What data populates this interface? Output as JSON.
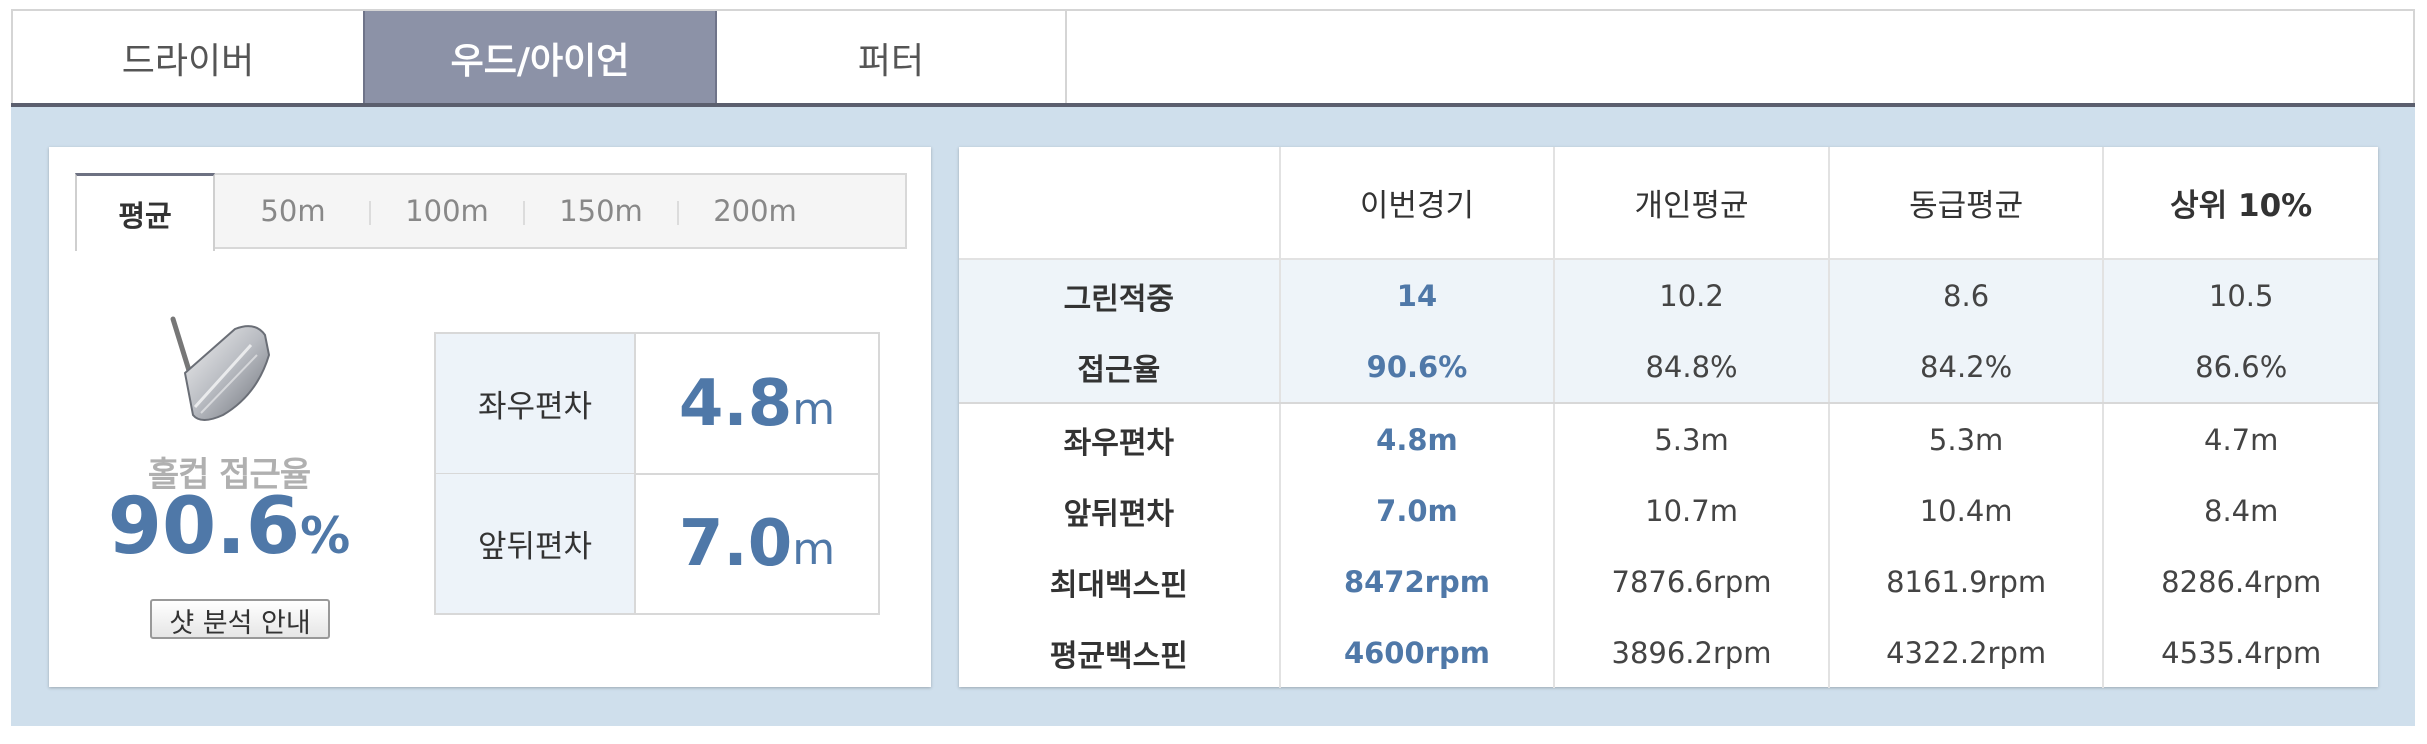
{
  "top_tabs": {
    "driver": "드라이버",
    "wood_iron": "우드/아이언",
    "putter": "퍼터"
  },
  "distance_tabs": [
    "평균",
    "50m",
    "100m",
    "150m",
    "200m"
  ],
  "summary": {
    "holecup_label": "홀컵 접근율",
    "holecup_value": "90.6",
    "holecup_unit": "%",
    "guide_button": "샷 분석 안내",
    "deviation": [
      {
        "label": "좌우편차",
        "value": "4.8",
        "unit": "m"
      },
      {
        "label": "앞뒤편차",
        "value": "7.0",
        "unit": "m"
      }
    ]
  },
  "stats": {
    "columns": [
      "이번경기",
      "개인평균",
      "동급평균",
      "상위 10%"
    ],
    "rows": [
      {
        "label": "그린적중",
        "values": [
          "14",
          "10.2",
          "8.6",
          "10.5"
        ]
      },
      {
        "label": "접근율",
        "values": [
          "90.6%",
          "84.8%",
          "84.2%",
          "86.6%"
        ]
      },
      {
        "label": "좌우편차",
        "values": [
          "4.8m",
          "5.3m",
          "5.3m",
          "4.7m"
        ]
      },
      {
        "label": "앞뒤편차",
        "values": [
          "7.0m",
          "10.7m",
          "10.4m",
          "8.4m"
        ]
      },
      {
        "label": "최대백스핀",
        "values": [
          "8472rpm",
          "7876.6rpm",
          "8161.9rpm",
          "8286.4rpm"
        ]
      },
      {
        "label": "평균백스핀",
        "values": [
          "4600rpm",
          "3896.2rpm",
          "4322.2rpm",
          "4535.4rpm"
        ]
      }
    ]
  },
  "colors": {
    "accent_blue": "#4f78a8",
    "active_tab": "#8c92a7",
    "content_bg": "#cfdfec"
  },
  "icons": {
    "club": "iron-club-icon"
  }
}
